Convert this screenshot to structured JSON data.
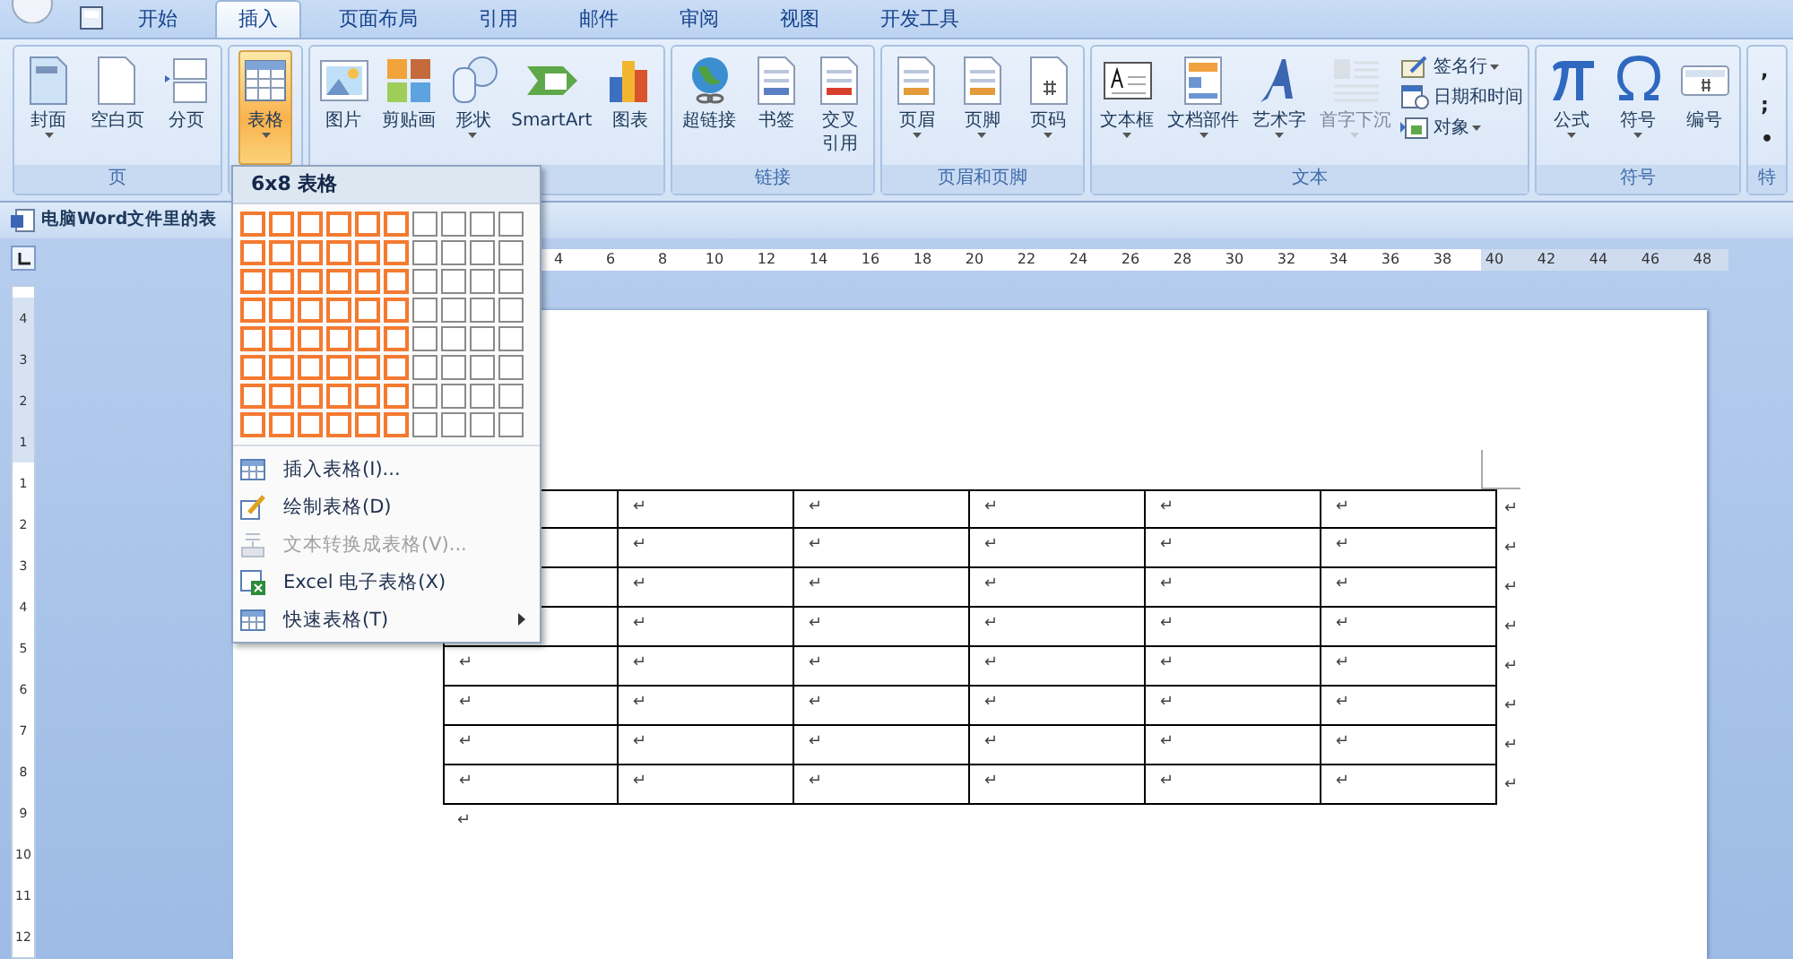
{
  "tabs": [
    {
      "label": "开始",
      "selected": false
    },
    {
      "label": "插入",
      "selected": true
    },
    {
      "label": "页面布局",
      "selected": false
    },
    {
      "label": "引用",
      "selected": false
    },
    {
      "label": "邮件",
      "selected": false
    },
    {
      "label": "审阅",
      "selected": false
    },
    {
      "label": "视图",
      "selected": false
    },
    {
      "label": "开发工具",
      "selected": false
    }
  ],
  "ribbon_groups": [
    {
      "label": "页",
      "items": [
        {
          "label": "封面",
          "kind": "large",
          "dropdown": true,
          "disabled": false,
          "selected": false
        },
        {
          "label": "空白页",
          "kind": "large",
          "dropdown": false,
          "disabled": false,
          "selected": false
        },
        {
          "label": "分页",
          "kind": "large",
          "dropdown": false,
          "disabled": false,
          "selected": false
        }
      ]
    },
    {
      "items": [
        {
          "label": "表格",
          "kind": "large",
          "dropdown": true,
          "disabled": false,
          "selected": true
        }
      ]
    },
    {
      "items": [
        {
          "label": "图片",
          "kind": "large",
          "dropdown": false,
          "disabled": false,
          "selected": false
        },
        {
          "label": "剪贴画",
          "kind": "large",
          "dropdown": false,
          "disabled": false,
          "selected": false
        },
        {
          "label": "形状",
          "kind": "large",
          "dropdown": true,
          "disabled": false,
          "selected": false
        },
        {
          "label": "SmartArt",
          "kind": "large",
          "dropdown": false,
          "disabled": false,
          "selected": false
        },
        {
          "label": "图表",
          "kind": "large",
          "dropdown": false,
          "disabled": false,
          "selected": false
        }
      ]
    },
    {
      "label": "链接",
      "items": [
        {
          "label": "超链接",
          "kind": "large",
          "dropdown": false,
          "disabled": false,
          "selected": false
        },
        {
          "label": "书签",
          "kind": "large",
          "dropdown": false,
          "disabled": false,
          "selected": false
        },
        {
          "label": "交叉引用",
          "kind": "narrow",
          "dropdown": false,
          "disabled": false,
          "selected": false
        }
      ]
    },
    {
      "label": "页眉和页脚",
      "items": [
        {
          "label": "页眉",
          "kind": "large",
          "dropdown": true,
          "disabled": false,
          "selected": false
        },
        {
          "label": "页脚",
          "kind": "large",
          "dropdown": true,
          "disabled": false,
          "selected": false
        },
        {
          "label": "页码",
          "kind": "large",
          "dropdown": true,
          "disabled": false,
          "selected": false
        }
      ]
    },
    {
      "label": "文本",
      "items": [
        {
          "label": "文本框",
          "kind": "large",
          "dropdown": true,
          "disabled": false,
          "selected": false
        },
        {
          "label": "文档部件",
          "kind": "large",
          "dropdown": true,
          "disabled": false,
          "selected": false
        },
        {
          "label": "艺术字",
          "kind": "large",
          "dropdown": true,
          "disabled": false,
          "selected": false
        },
        {
          "label": "首字下沉",
          "kind": "large",
          "dropdown": true,
          "disabled": true,
          "selected": false
        },
        {
          "label": "签名行",
          "kind": "small",
          "dropdown": true
        },
        {
          "label": "日期和时间",
          "kind": "small",
          "dropdown": false
        },
        {
          "label": "对象",
          "kind": "small",
          "dropdown": true
        }
      ]
    },
    {
      "label": "符号",
      "items": [
        {
          "label": "公式",
          "kind": "large",
          "dropdown": true,
          "disabled": false,
          "selected": false
        },
        {
          "label": "符号",
          "kind": "large",
          "dropdown": true,
          "disabled": false,
          "selected": false
        },
        {
          "label": "编号",
          "kind": "large",
          "dropdown": false,
          "disabled": false,
          "selected": false
        }
      ]
    },
    {
      "label": "特",
      "items": [
        {
          "label": ",",
          "kind": "glyph"
        },
        {
          "label": ";",
          "kind": "glyph"
        },
        {
          "label": "•",
          "kind": "glyph"
        }
      ]
    }
  ],
  "document_tab": {
    "title": "电脑Word文件里的表"
  },
  "ruler_numbers": [
    "4",
    "6",
    "8",
    "10",
    "12",
    "14",
    "16",
    "18",
    "20",
    "22",
    "24",
    "26",
    "28",
    "30",
    "32",
    "34",
    "36",
    "38",
    "40",
    "42",
    "44",
    "46",
    "48"
  ],
  "vertical_ruler_numbers": [
    "4",
    "3",
    "2",
    "1",
    "1",
    "2",
    "3",
    "4",
    "5",
    "6",
    "7",
    "8",
    "9",
    "10",
    "11",
    "12"
  ],
  "table_menu": {
    "header": "6x8 表格",
    "grid": [
      [
        {
          "selected": true
        },
        {
          "selected": true
        },
        {
          "selected": true
        },
        {
          "selected": true
        },
        {
          "selected": true
        },
        {
          "selected": true
        },
        {
          "selected": false
        },
        {
          "selected": false
        },
        {
          "selected": false
        },
        {
          "selected": false
        }
      ],
      [
        {
          "selected": true
        },
        {
          "selected": true
        },
        {
          "selected": true
        },
        {
          "selected": true
        },
        {
          "selected": true
        },
        {
          "selected": true
        },
        {
          "selected": false
        },
        {
          "selected": false
        },
        {
          "selected": false
        },
        {
          "selected": false
        }
      ],
      [
        {
          "selected": true
        },
        {
          "selected": true
        },
        {
          "selected": true
        },
        {
          "selected": true
        },
        {
          "selected": true
        },
        {
          "selected": true
        },
        {
          "selected": false
        },
        {
          "selected": false
        },
        {
          "selected": false
        },
        {
          "selected": false
        }
      ],
      [
        {
          "selected": true
        },
        {
          "selected": true
        },
        {
          "selected": true
        },
        {
          "selected": true
        },
        {
          "selected": true
        },
        {
          "selected": true
        },
        {
          "selected": false
        },
        {
          "selected": false
        },
        {
          "selected": false
        },
        {
          "selected": false
        }
      ],
      [
        {
          "selected": true
        },
        {
          "selected": true
        },
        {
          "selected": true
        },
        {
          "selected": true
        },
        {
          "selected": true
        },
        {
          "selected": true
        },
        {
          "selected": false
        },
        {
          "selected": false
        },
        {
          "selected": false
        },
        {
          "selected": false
        }
      ],
      [
        {
          "selected": true
        },
        {
          "selected": true
        },
        {
          "selected": true
        },
        {
          "selected": true
        },
        {
          "selected": true
        },
        {
          "selected": true
        },
        {
          "selected": false
        },
        {
          "selected": false
        },
        {
          "selected": false
        },
        {
          "selected": false
        }
      ],
      [
        {
          "selected": true
        },
        {
          "selected": true
        },
        {
          "selected": true
        },
        {
          "selected": true
        },
        {
          "selected": true
        },
        {
          "selected": true
        },
        {
          "selected": false
        },
        {
          "selected": false
        },
        {
          "selected": false
        },
        {
          "selected": false
        }
      ],
      [
        {
          "selected": true
        },
        {
          "selected": true
        },
        {
          "selected": true
        },
        {
          "selected": true
        },
        {
          "selected": true
        },
        {
          "selected": true
        },
        {
          "selected": false
        },
        {
          "selected": false
        },
        {
          "selected": false
        },
        {
          "selected": false
        }
      ]
    ],
    "items": [
      {
        "label": "插入表格(I)...",
        "disabled": false,
        "submenu": false
      },
      {
        "label": "绘制表格(D)",
        "disabled": false,
        "submenu": false
      },
      {
        "label": "文本转换成表格(V)...",
        "disabled": true,
        "submenu": false
      },
      {
        "label": "Excel 电子表格(X)",
        "disabled": false,
        "submenu": false
      },
      {
        "label": "快速表格(T)",
        "disabled": false,
        "submenu": true
      }
    ]
  },
  "table": {
    "rows": [
      {
        "cells": [
          {},
          {
            "text": "↵"
          },
          {
            "text": "↵"
          },
          {
            "text": "↵"
          },
          {
            "text": "↵"
          },
          {
            "text": "↵"
          }
        ],
        "end_mark": "↵"
      },
      {
        "cells": [
          {},
          {
            "text": "↵"
          },
          {
            "text": "↵"
          },
          {
            "text": "↵"
          },
          {
            "text": "↵"
          },
          {
            "text": "↵"
          }
        ],
        "end_mark": "↵"
      },
      {
        "cells": [
          {},
          {
            "text": "↵"
          },
          {
            "text": "↵"
          },
          {
            "text": "↵"
          },
          {
            "text": "↵"
          },
          {
            "text": "↵"
          }
        ],
        "end_mark": "↵"
      },
      {
        "cells": [
          {},
          {
            "text": "↵"
          },
          {
            "text": "↵"
          },
          {
            "text": "↵"
          },
          {
            "text": "↵"
          },
          {
            "text": "↵"
          }
        ],
        "end_mark": "↵"
      },
      {
        "cells": [
          {
            "text": "↵"
          },
          {
            "text": "↵"
          },
          {
            "text": "↵"
          },
          {
            "text": "↵"
          },
          {
            "text": "↵"
          },
          {
            "text": "↵"
          }
        ],
        "end_mark": "↵"
      },
      {
        "cells": [
          {
            "text": "↵"
          },
          {
            "text": "↵"
          },
          {
            "text": "↵"
          },
          {
            "text": "↵"
          },
          {
            "text": "↵"
          },
          {
            "text": "↵"
          }
        ],
        "end_mark": "↵"
      },
      {
        "cells": [
          {
            "text": "↵"
          },
          {
            "text": "↵"
          },
          {
            "text": "↵"
          },
          {
            "text": "↵"
          },
          {
            "text": "↵"
          },
          {
            "text": "↵"
          }
        ],
        "end_mark": "↵"
      },
      {
        "cells": [
          {
            "text": "↵"
          },
          {
            "text": "↵"
          },
          {
            "text": "↵"
          },
          {
            "text": "↵"
          },
          {
            "text": "↵"
          },
          {
            "text": "↵"
          }
        ],
        "end_mark": "↵"
      }
    ]
  },
  "paragraph_mark": "↵"
}
